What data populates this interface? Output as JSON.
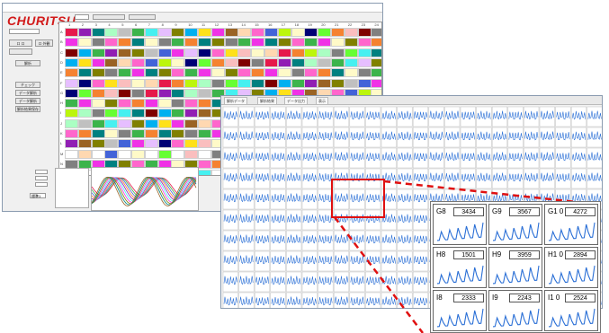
{
  "window1": {
    "logo": "CHURITSU",
    "plate_buttons": [
      "ロ ロ",
      "ロ 外観"
    ],
    "side_buttons": [
      "解析",
      "チェック",
      "データ解析",
      "データ解析",
      "解析結果保存"
    ],
    "bottom_select": "標準1",
    "grid_rows": [
      "A",
      "B",
      "C",
      "D",
      "E",
      "F",
      "G",
      "H",
      "I",
      "J",
      "K",
      "L",
      "M",
      "N",
      "O",
      "P"
    ],
    "grid_cols": [
      "1",
      "2",
      "3",
      "4",
      "5",
      "6",
      "7",
      "8",
      "9",
      "10",
      "11",
      "12",
      "13",
      "14",
      "15",
      "16",
      "17",
      "18",
      "19",
      "20",
      "21",
      "22",
      "23",
      "24"
    ]
  },
  "window2": {
    "tabs": [
      "解析データ",
      "解析結果",
      "データ出力",
      "表示"
    ]
  },
  "zoom_panel": {
    "cells": [
      {
        "label": "G8",
        "value": "3434"
      },
      {
        "label": "G9",
        "value": "3567"
      },
      {
        "label": "G1 0",
        "value": "4272"
      },
      {
        "label": "H8",
        "value": "1501"
      },
      {
        "label": "H9",
        "value": "3959"
      },
      {
        "label": "H1 0",
        "value": "2894"
      },
      {
        "label": "I8",
        "value": "2333"
      },
      {
        "label": "I9",
        "value": "2243"
      },
      {
        "label": "I1 0",
        "value": "2524"
      }
    ]
  },
  "colors": {
    "logo": "#d21a1a",
    "callout": "#e01010",
    "trace": "#2a6fd6",
    "palette": [
      "#e6194b",
      "#3cb44b",
      "#ffe119",
      "#4363d8",
      "#f58231",
      "#911eb4",
      "#46f0f0",
      "#f032e6",
      "#bcf60c",
      "#fabebe",
      "#008080",
      "#e6beff",
      "#9a6324",
      "#fffac8",
      "#800000",
      "#aaffc3",
      "#808000",
      "#ffd8b1",
      "#000075",
      "#808080",
      "#c0c0c0",
      "#00b0f0",
      "#ff66cc",
      "#66ff33"
    ]
  }
}
